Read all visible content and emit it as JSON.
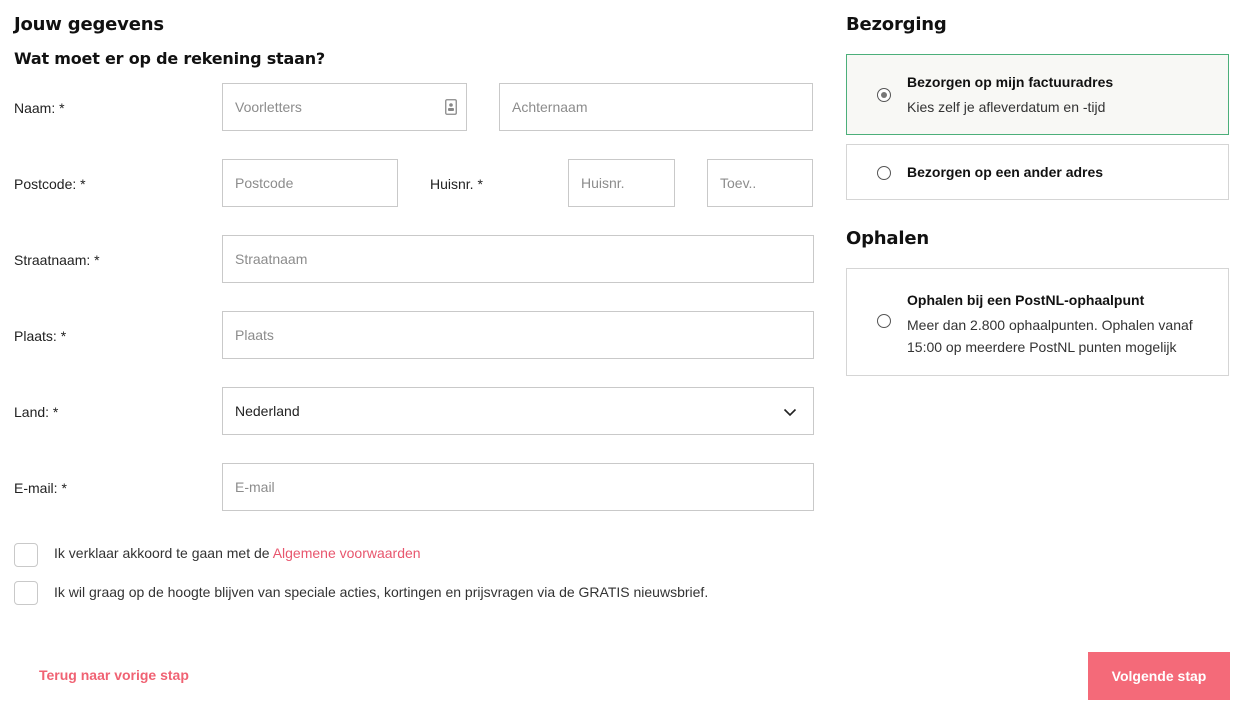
{
  "left": {
    "title": "Jouw gegevens",
    "subtitle": "Wat moet er op de rekening staan?",
    "fields": {
      "name_label": "Naam: *",
      "initials_placeholder": "Voorletters",
      "lastname_placeholder": "Achternaam",
      "postcode_label": "Postcode: *",
      "postcode_placeholder": "Postcode",
      "housenr_label": "Huisnr. *",
      "housenr_placeholder": "Huisnr.",
      "addition_placeholder": "Toev..",
      "street_label": "Straatnaam: *",
      "street_placeholder": "Straatnaam",
      "city_label": "Plaats: *",
      "city_placeholder": "Plaats",
      "country_label": "Land: *",
      "country_value": "Nederland",
      "email_label": "E-mail: *",
      "email_placeholder": "E-mail"
    },
    "checkboxes": {
      "terms_text": "Ik verklaar akkoord te gaan met de ",
      "terms_link": "Algemene voorwaarden",
      "newsletter_text": "Ik wil graag op de hoogte blijven van speciale acties, kortingen en prijsvragen via de GRATIS nieuwsbrief."
    },
    "back_link": "Terug naar vorige stap"
  },
  "right": {
    "delivery_title": "Bezorging",
    "option_invoice_title": "Bezorgen op mijn factuuradres",
    "option_invoice_desc": "Kies zelf je afleverdatum en -tijd",
    "option_other_title": "Bezorgen op een ander adres",
    "pickup_title": "Ophalen",
    "option_pickup_title": "Ophalen bij een PostNL-ophaalpunt",
    "option_pickup_desc": "Meer dan 2.800 ophaalpunten. Ophalen vanaf 15:00 op meerdere PostNL punten mogelijk"
  },
  "next_button": "Volgende stap",
  "colors": {
    "accent": "#f46a79",
    "link": "#e8566e",
    "selected_border": "#4caf7a"
  }
}
